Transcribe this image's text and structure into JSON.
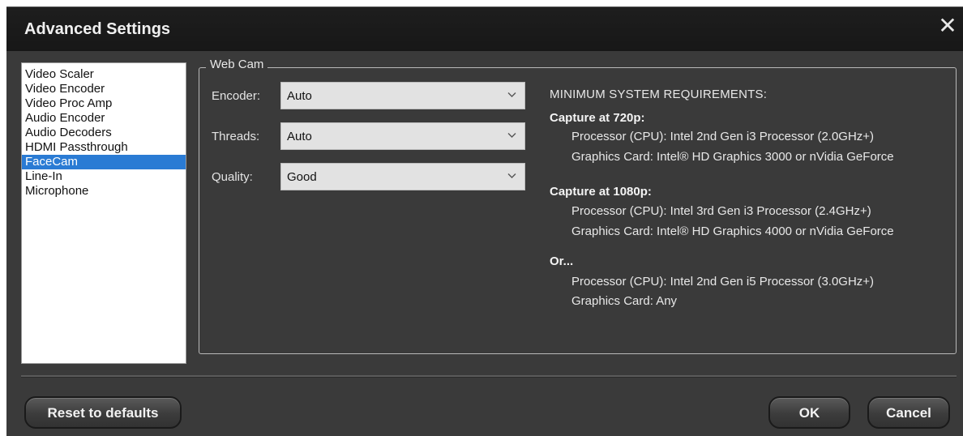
{
  "window": {
    "title": "Advanced Settings",
    "close_symbol": "✕"
  },
  "sidebar": {
    "items": [
      {
        "label": "Video Scaler",
        "selected": false
      },
      {
        "label": "Video Encoder",
        "selected": false
      },
      {
        "label": "Video Proc Amp",
        "selected": false
      },
      {
        "label": "Audio Encoder",
        "selected": false
      },
      {
        "label": "Audio Decoders",
        "selected": false
      },
      {
        "label": "HDMI Passthrough",
        "selected": false
      },
      {
        "label": "FaceCam",
        "selected": true
      },
      {
        "label": "Line-In",
        "selected": false
      },
      {
        "label": "Microphone",
        "selected": false
      }
    ],
    "selection_color": "#2a7bd4"
  },
  "webcam": {
    "group_title": "Web Cam",
    "encoder": {
      "label": "Encoder:",
      "value": "Auto"
    },
    "threads": {
      "label": "Threads:",
      "value": "Auto"
    },
    "quality": {
      "label": "Quality:",
      "value": "Good"
    }
  },
  "requirements": {
    "heading": "MINIMUM SYSTEM REQUIREMENTS:",
    "blocks": [
      {
        "title": "Capture at 720p:",
        "cpu": "Processor (CPU): Intel 2nd Gen i3 Processor (2.0GHz+)",
        "gpu": "Graphics Card:  Intel® HD Graphics 3000 or nVidia GeForce"
      },
      {
        "title": "Capture at 1080p:",
        "cpu": "Processor (CPU): Intel 3rd Gen i3 Processor (2.4GHz+)",
        "gpu": "Graphics Card:  Intel® HD Graphics 4000 or nVidia GeForce"
      },
      {
        "title": "Or...",
        "cpu": "Processor (CPU): Intel 2nd Gen i5 Processor (3.0GHz+)",
        "gpu": "Graphics Card:  Any"
      }
    ]
  },
  "footer": {
    "reset_label": "Reset to defaults",
    "ok_label": "OK",
    "cancel_label": "Cancel"
  }
}
